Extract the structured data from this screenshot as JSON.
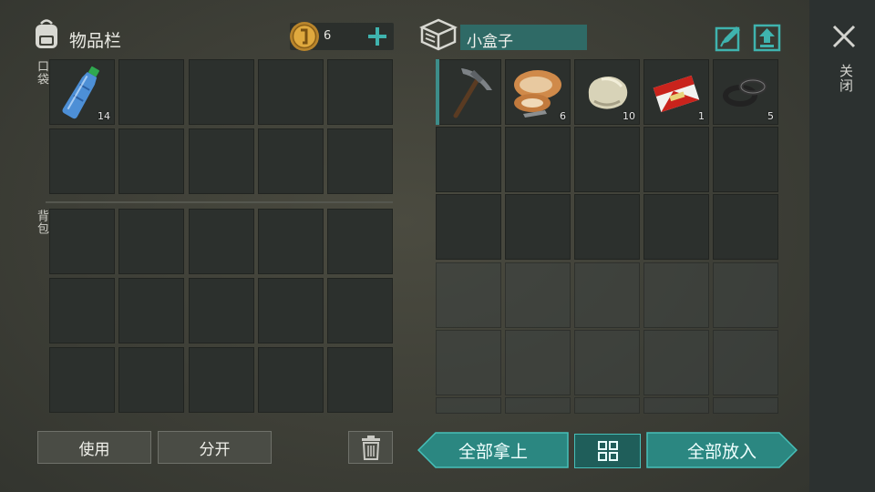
{
  "left_panel": {
    "title": "物品栏",
    "icon": "backpack-icon",
    "coins": "6",
    "coin_icon": "coin-icon",
    "add_icon": "plus-icon",
    "pocket_label": "口袋",
    "backpack_label": "背包",
    "pocket_slots": [
      {
        "item": "water-bottle",
        "qty": "14"
      },
      {},
      {},
      {},
      {},
      {},
      {},
      {},
      {},
      {}
    ],
    "backpack_slot_count": 15
  },
  "right_panel": {
    "container_icon": "box-icon",
    "container_name": "小盒子",
    "edit_icon": "edit-icon",
    "upload_icon": "upload-icon",
    "slots": [
      {
        "item": "pickaxe",
        "qty": ""
      },
      {
        "item": "mushroom-meat",
        "qty": "6"
      },
      {
        "item": "stone",
        "qty": "10"
      },
      {
        "item": "cigarette-pack",
        "qty": "1"
      },
      {
        "item": "rubber-rings",
        "qty": "5"
      }
    ]
  },
  "close": {
    "icon": "close-icon",
    "label": "关闭"
  },
  "buttons": {
    "use": "使用",
    "split": "分开",
    "trash_icon": "trash-icon",
    "take_all": "全部拿上",
    "sort_icon": "grid-sort-icon",
    "put_all": "全部放入"
  },
  "colors": {
    "accent": "#2f8f8a",
    "accent_light": "#4fc3bd",
    "slot": "#2c302d",
    "background": "#3e3f37"
  }
}
